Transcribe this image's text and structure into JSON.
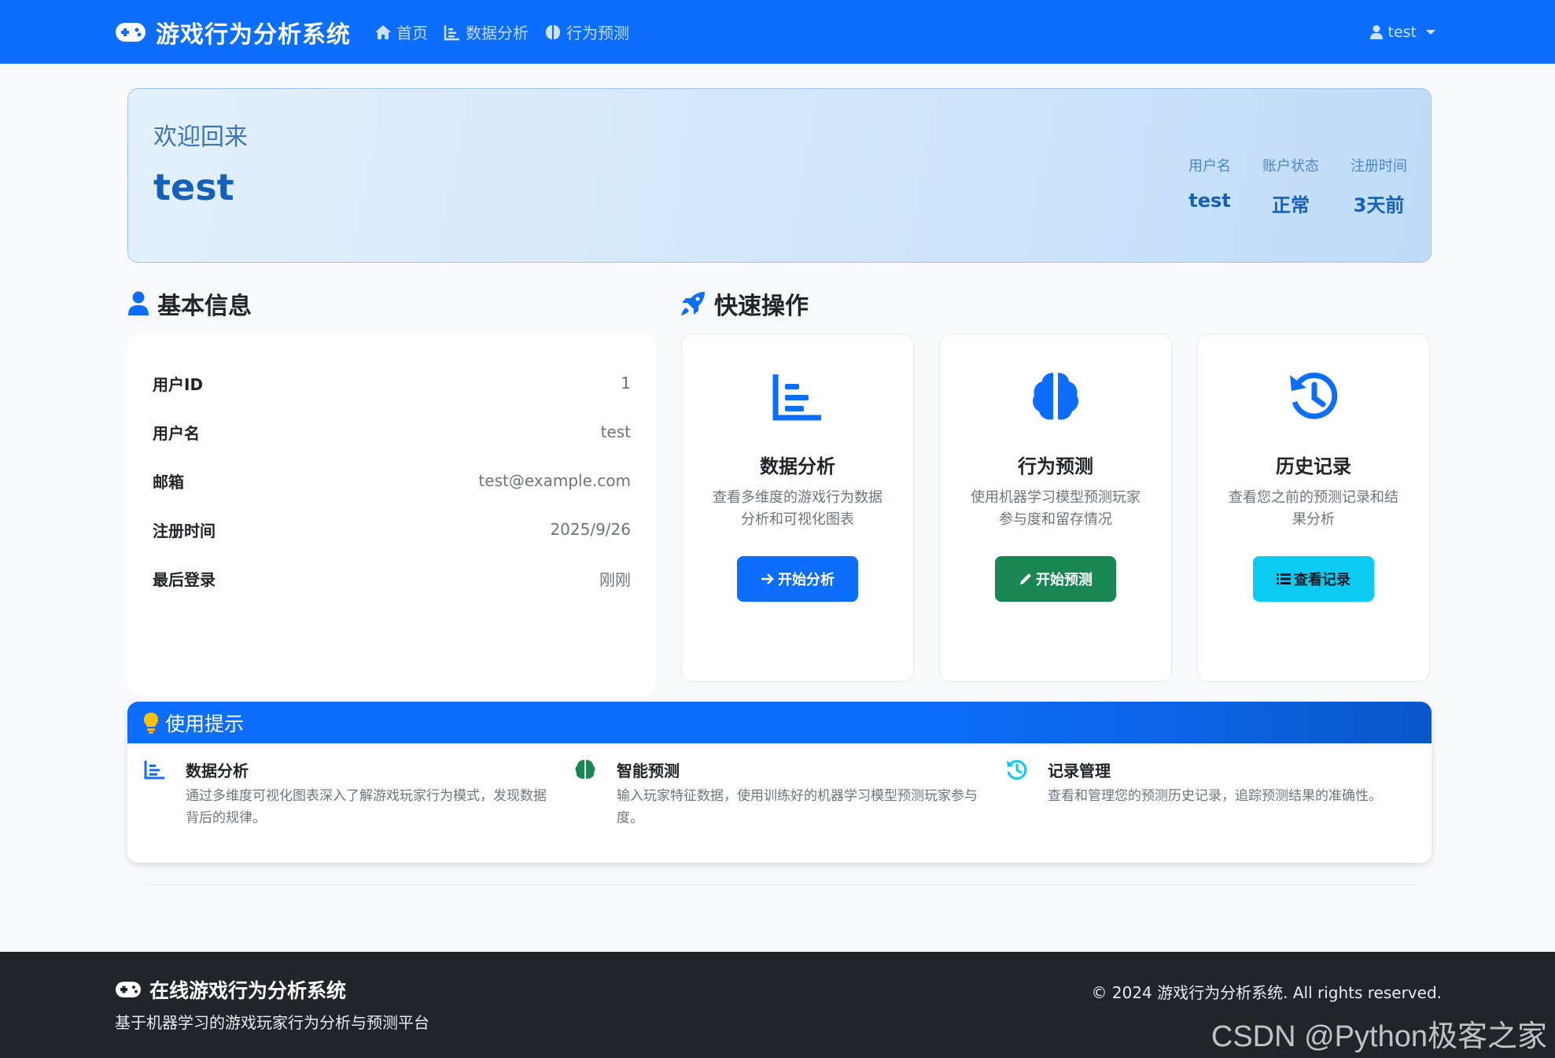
{
  "nav": {
    "brand": "游戏行为分析系统",
    "links": [
      {
        "label": "首页",
        "icon": "home-icon"
      },
      {
        "label": "数据分析",
        "icon": "chart-bar-icon"
      },
      {
        "label": "行为预测",
        "icon": "brain-icon"
      }
    ],
    "user": "test"
  },
  "welcome": {
    "subtitle": "欢迎回来",
    "name": "test",
    "stats": [
      {
        "label": "用户名",
        "value": "test"
      },
      {
        "label": "账户状态",
        "value": "正常"
      },
      {
        "label": "注册时间",
        "value": "3天前"
      }
    ]
  },
  "basic_info": {
    "title": "基本信息",
    "rows": [
      {
        "key": "用户ID",
        "value": "1"
      },
      {
        "key": "用户名",
        "value": "test"
      },
      {
        "key": "邮箱",
        "value": "test@example.com"
      },
      {
        "key": "注册时间",
        "value": "2025/9/26"
      },
      {
        "key": "最后登录",
        "value": "刚刚"
      }
    ]
  },
  "quick_actions": {
    "title": "快速操作",
    "cards": [
      {
        "title": "数据分析",
        "desc_line1": "查看多维度的游戏行为数据",
        "desc_line2": "分析和可视化图表",
        "button": "开始分析",
        "color": "#0d6efd"
      },
      {
        "title": "行为预测",
        "desc_line1": "使用机器学习模型预测玩家",
        "desc_line2": "参与度和留存情况",
        "button": "开始预测",
        "color": "#198754"
      },
      {
        "title": "历史记录",
        "desc_line1": "查看您之前的预测记录和结",
        "desc_line2": "果分析",
        "button": "查看记录",
        "color": "#0dcaf0"
      }
    ]
  },
  "tips": {
    "title": "使用提示",
    "items": [
      {
        "title": "数据分析",
        "desc": "通过多维度可视化图表深入了解游戏玩家行为模式，发现数据背后的规律。"
      },
      {
        "title": "智能预测",
        "desc": "输入玩家特征数据，使用训练好的机器学习模型预测玩家参与度。"
      },
      {
        "title": "记录管理",
        "desc": "查看和管理您的预测历史记录，追踪预测结果的准确性。"
      }
    ]
  },
  "footer": {
    "brand": "在线游戏行为分析系统",
    "subtitle": "基于机器学习的游戏玩家行为分析与预测平台",
    "copyright": "© 2024 游戏行为分析系统. All rights reserved.",
    "watermark": "CSDN @Python极客之家"
  },
  "colors": {
    "primary": "#0d6efd",
    "success": "#198754",
    "info": "#0dcaf0",
    "dark": "#212529"
  }
}
